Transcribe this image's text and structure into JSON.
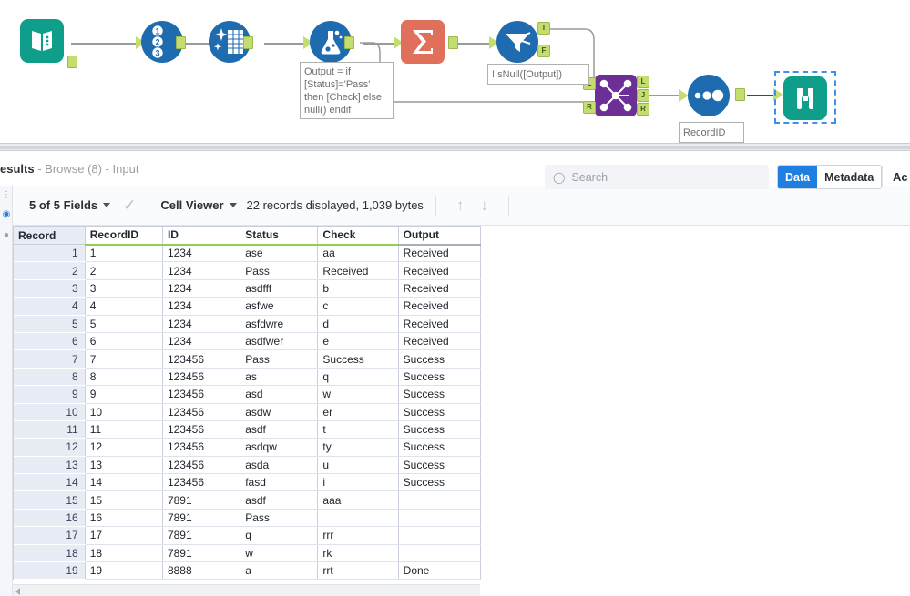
{
  "canvas": {
    "tools": [
      {
        "id": "input-data",
        "name": "Input Data",
        "icon": "book-icon"
      },
      {
        "id": "record-id",
        "name": "Record ID",
        "icon": "numbered-list-icon",
        "digits": [
          "1",
          "2",
          "3"
        ]
      },
      {
        "id": "data-cleansing",
        "name": "Data Cleansing",
        "icon": "data-cleansing-icon"
      },
      {
        "id": "formula",
        "name": "Formula",
        "icon": "flask-icon"
      },
      {
        "id": "summarize",
        "name": "Summarize",
        "icon": "sigma-icon",
        "glyph": "Σ"
      },
      {
        "id": "filter",
        "name": "Filter",
        "icon": "funnel-icon",
        "ports": [
          "T",
          "F"
        ]
      },
      {
        "id": "join",
        "name": "Join",
        "icon": "join-icon",
        "inputs": [
          "L",
          "R"
        ],
        "outputs": [
          "L",
          "J",
          "R"
        ]
      },
      {
        "id": "select",
        "name": "Select",
        "icon": "three-dots-icon"
      },
      {
        "id": "browse",
        "name": "Browse",
        "icon": "binoculars-icon",
        "selected": true
      }
    ],
    "annotations": [
      {
        "id": "formula-annotation",
        "text": "Output = if\n[Status]='Pass'\nthen [Check] else\nnull() endif"
      },
      {
        "id": "filter-annotation",
        "text": "!IsNull([Output])"
      },
      {
        "id": "recordid-annotation",
        "text": "RecordID"
      }
    ],
    "colors": {
      "input_teal": "#0e9e8a",
      "tool_blue": "#1f6bb0",
      "summarize_orange": "#e0705c",
      "join_purple": "#6b2f96",
      "port_green": "#c3dd6e",
      "wire_gray": "#9a9a9a",
      "wire_blue": "#3b2fd0",
      "selection_blue": "#3d8ff0"
    }
  },
  "results": {
    "title_bold": "esults",
    "title_rest": " - Browse (8) - Input",
    "toolbar": {
      "fields_label": "5 of 5 Fields",
      "check_icon": "checkmark-icon",
      "viewer_label": "Cell Viewer",
      "record_count": "22 records displayed, 1,039 bytes",
      "up_arrow": "↑",
      "down_arrow": "↓"
    },
    "search": {
      "placeholder": "Search",
      "icon": "search-icon"
    },
    "tabs": {
      "data": "Data",
      "metadata": "Metadata",
      "actions": "Ac"
    },
    "table": {
      "columns": [
        "Record",
        "RecordID",
        "ID",
        "Status",
        "Check",
        "Output"
      ],
      "rows": [
        [
          "1",
          "1",
          "1234",
          "ase",
          "aa",
          "Received"
        ],
        [
          "2",
          "2",
          "1234",
          "Pass",
          "Received",
          "Received"
        ],
        [
          "3",
          "3",
          "1234",
          "asdfff",
          "b",
          "Received"
        ],
        [
          "4",
          "4",
          "1234",
          "asfwe",
          "c",
          "Received"
        ],
        [
          "5",
          "5",
          "1234",
          "asfdwre",
          "d",
          "Received"
        ],
        [
          "6",
          "6",
          "1234",
          "asdfwer",
          "e",
          "Received"
        ],
        [
          "7",
          "7",
          "123456",
          "Pass",
          "Success",
          "Success"
        ],
        [
          "8",
          "8",
          "123456",
          "as",
          "q",
          "Success"
        ],
        [
          "9",
          "9",
          "123456",
          "asd",
          "w",
          "Success"
        ],
        [
          "10",
          "10",
          "123456",
          "asdw",
          "er",
          "Success"
        ],
        [
          "11",
          "11",
          "123456",
          "asdf",
          "t",
          "Success"
        ],
        [
          "12",
          "12",
          "123456",
          "asdqw",
          "ty",
          "Success"
        ],
        [
          "13",
          "13",
          "123456",
          "asda",
          "u",
          "Success"
        ],
        [
          "14",
          "14",
          "123456",
          "fasd",
          "i",
          "Success"
        ],
        [
          "15",
          "15",
          "7891",
          "asdf",
          "aaa",
          ""
        ],
        [
          "16",
          "16",
          "7891",
          "Pass",
          "",
          ""
        ],
        [
          "17",
          "17",
          "7891",
          "q",
          "rrr",
          ""
        ],
        [
          "18",
          "18",
          "7891",
          "w",
          "rk",
          ""
        ],
        [
          "19",
          "19",
          "8888",
          "a",
          "rrt",
          "Done"
        ]
      ]
    }
  }
}
